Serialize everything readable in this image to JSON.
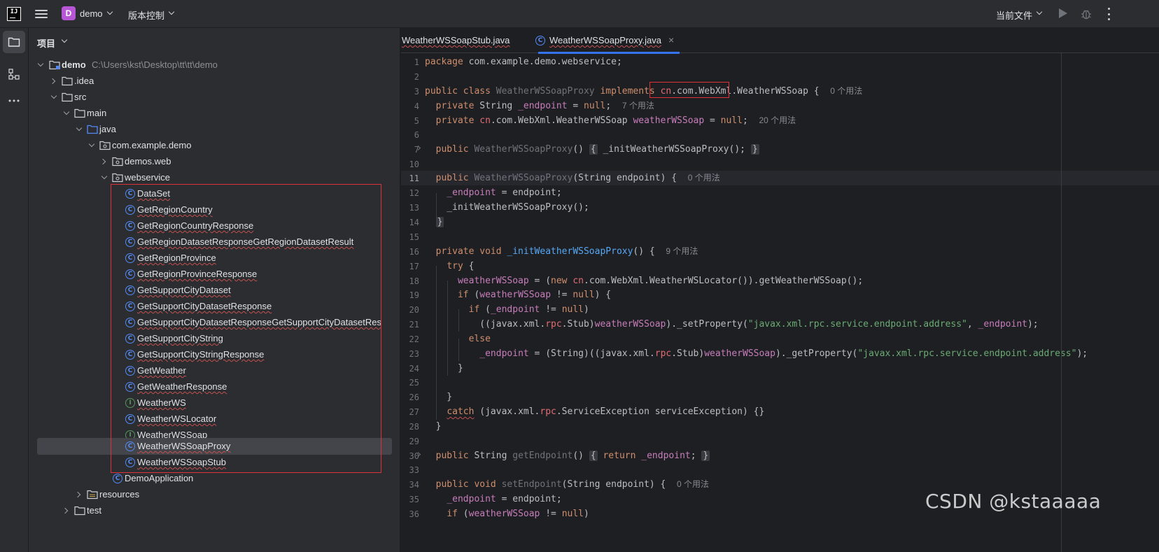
{
  "titlebar": {
    "logo_text": "IJ",
    "project_badge": "D",
    "project_name": "demo",
    "vcs_label": "版本控制",
    "run_config": "当前文件"
  },
  "panel": {
    "title": "项目"
  },
  "tree": {
    "root_name": "demo",
    "root_path": "C:\\Users\\kst\\Desktop\\tt\\tt\\demo",
    "idea": ".idea",
    "src": "src",
    "main": "main",
    "java": "java",
    "package": "com.example.demo",
    "demos_web": "demos.web",
    "webservice": "webservice",
    "classes": [
      {
        "name": "DataSet",
        "kind": "class"
      },
      {
        "name": "GetRegionCountry",
        "kind": "class"
      },
      {
        "name": "GetRegionCountryResponse",
        "kind": "class"
      },
      {
        "name": "GetRegionDatasetResponseGetRegionDatasetResult",
        "kind": "class"
      },
      {
        "name": "GetRegionProvince",
        "kind": "class"
      },
      {
        "name": "GetRegionProvinceResponse",
        "kind": "class"
      },
      {
        "name": "GetSupportCityDataset",
        "kind": "class"
      },
      {
        "name": "GetSupportCityDatasetResponse",
        "kind": "class"
      },
      {
        "name": "GetSupportCityDatasetResponseGetSupportCityDatasetRes",
        "kind": "class"
      },
      {
        "name": "GetSupportCityString",
        "kind": "class"
      },
      {
        "name": "GetSupportCityStringResponse",
        "kind": "class"
      },
      {
        "name": "GetWeather",
        "kind": "class"
      },
      {
        "name": "GetWeatherResponse",
        "kind": "class"
      },
      {
        "name": "WeatherWS",
        "kind": "interface"
      },
      {
        "name": "WeatherWSLocator",
        "kind": "class"
      },
      {
        "name": "WeatherWSSoap",
        "kind": "interface"
      },
      {
        "name": "WeatherWSSoapProxy",
        "kind": "class",
        "selected": true
      },
      {
        "name": "WeatherWSSoapStub",
        "kind": "class"
      }
    ],
    "demo_application": "DemoApplication",
    "resources": "resources",
    "test": "test"
  },
  "tabs": [
    {
      "label": "WeatherWSSoapStub.java",
      "active": false
    },
    {
      "label": "WeatherWSSoapProxy.java",
      "active": true
    }
  ],
  "editor": {
    "current_line": 11,
    "line_numbers": [
      "1",
      "2",
      "3",
      "4",
      "5",
      "6",
      "7",
      "10",
      "11",
      "12",
      "13",
      "14",
      "15",
      "16",
      "17",
      "18",
      "19",
      "20",
      "21",
      "22",
      "23",
      "24",
      "25",
      "26",
      "27",
      "28",
      "29",
      "30",
      "33",
      "34",
      "35",
      "36"
    ],
    "hints": {
      "l3": "0 个用法",
      "l4": "7 个用法",
      "l5": "20 个用法",
      "l11": "0 个用法",
      "l16": "9 个用法",
      "l34": "0 个用法"
    }
  },
  "watermark": "CSDN @kstaaaaa",
  "colors": {
    "accent": "#3574f0",
    "highlight_box": "#e0303a",
    "keyword": "#cf8e6d",
    "field": "#c77dbb",
    "string": "#6aab73",
    "method": "#56a8f5"
  }
}
